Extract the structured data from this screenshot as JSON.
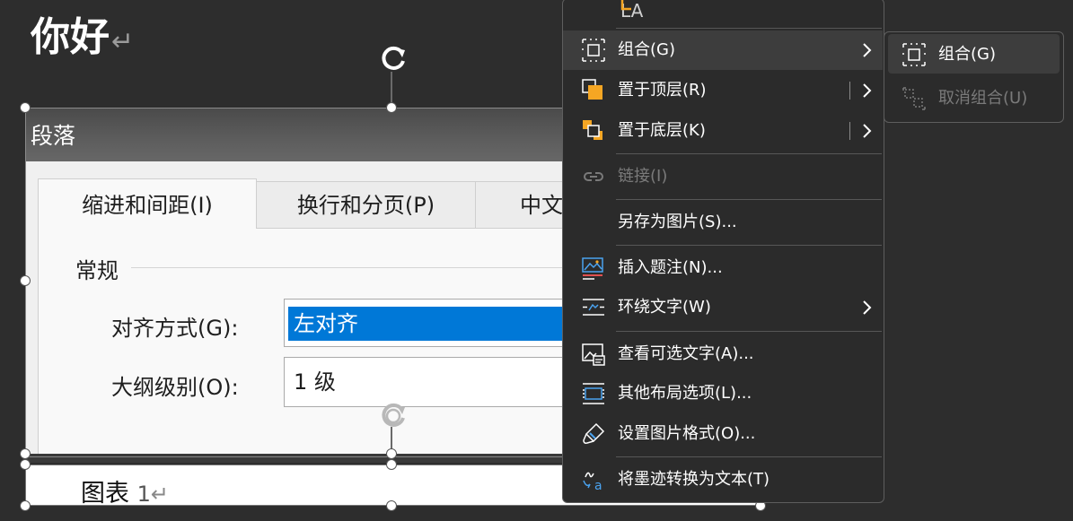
{
  "document": {
    "heading": "你好",
    "caption_label": "图表",
    "caption_number": "1"
  },
  "picture": {
    "dialog_title": "段落",
    "tabs": [
      {
        "label": "缩进和间距(I)",
        "active": true
      },
      {
        "label": "换行和分页(P)",
        "active": false
      },
      {
        "label": "中文",
        "active": false
      }
    ],
    "group_label": "常规",
    "alignment_label": "对齐方式(G):",
    "alignment_value": "左对齐",
    "outline_label": "大纲级别(O):",
    "outline_value": "1 级"
  },
  "context_menu": {
    "items": [
      {
        "label": "LA",
        "icon": "partial-top-icon",
        "disabled": false
      },
      {
        "label": "组合(G)",
        "icon": "group-icon",
        "submenu": true,
        "highlighted": true
      },
      {
        "label": "置于顶层(R)",
        "icon": "bring-to-front-icon",
        "submenu": true,
        "split": true
      },
      {
        "label": "置于底层(K)",
        "icon": "send-to-back-icon",
        "submenu": true,
        "split": true
      },
      {
        "label": "链接(I)",
        "icon": "link-icon",
        "disabled": true
      },
      {
        "label": "另存为图片(S)...",
        "icon": "",
        "disabled": false
      },
      {
        "label": "插入题注(N)...",
        "icon": "insert-caption-icon",
        "disabled": false
      },
      {
        "label": "环绕文字(W)",
        "icon": "wrap-text-icon",
        "submenu": true
      },
      {
        "label": "查看可选文字(A)...",
        "icon": "alt-text-icon",
        "disabled": false
      },
      {
        "label": "其他布局选项(L)...",
        "icon": "layout-options-icon",
        "disabled": false
      },
      {
        "label": "设置图片格式(O)...",
        "icon": "format-picture-icon",
        "disabled": false
      },
      {
        "label": "将墨迹转换为文本(T)",
        "icon": "ink-to-text-icon",
        "disabled": false
      }
    ]
  },
  "submenu": {
    "items": [
      {
        "label": "组合(G)",
        "icon": "group-icon",
        "highlighted": true
      },
      {
        "label": "取消组合(U)",
        "icon": "ungroup-icon",
        "disabled": true
      }
    ]
  },
  "colors": {
    "background": "#2d2d2d",
    "menu_background": "#2b2b2b",
    "menu_highlight": "#3d3d3d",
    "selection_blue": "#0078d7",
    "icon_orange": "#f5a623",
    "icon_blue": "#4aa3f0"
  }
}
